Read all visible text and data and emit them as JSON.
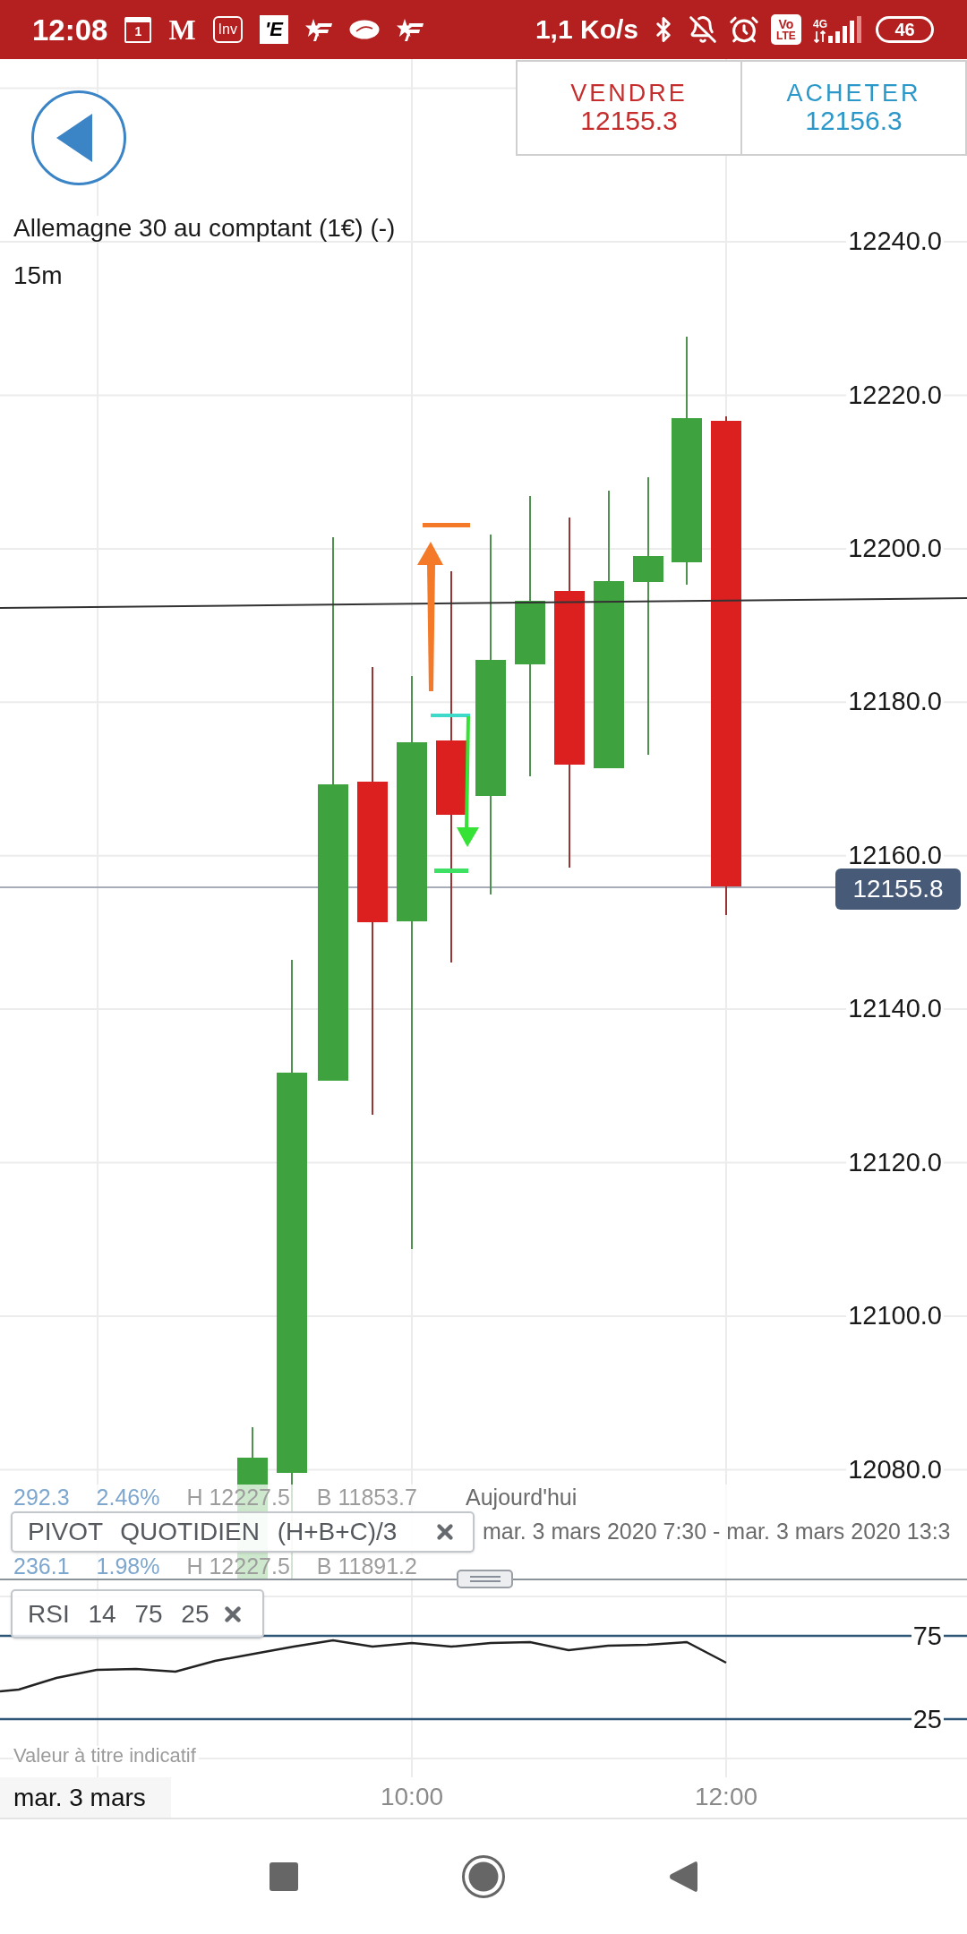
{
  "status_bar": {
    "time": "12:08",
    "notification_icons": [
      {
        "kind": "calendar",
        "text": "1"
      },
      {
        "kind": "serif_letter",
        "text": "M"
      },
      {
        "kind": "outlined_text",
        "text": "Inv"
      },
      {
        "kind": "tile_letter",
        "text": "'E"
      },
      {
        "kind": "star_logo"
      },
      {
        "kind": "oval_logo"
      },
      {
        "kind": "star_logo"
      }
    ],
    "net_speed": "1,1 Ko/s",
    "volte": {
      "top": "Vo",
      "bottom": "LTE"
    },
    "network_type": "4G",
    "battery": "46"
  },
  "trade_buttons": [
    {
      "kind": "sell",
      "label": "VENDRE",
      "price": "12155.3"
    },
    {
      "kind": "buy",
      "label": "ACHETER",
      "price": "12156.3"
    }
  ],
  "chart": {
    "instrument": "Allemagne 30 au comptant (1€) (-)",
    "timeframe": "15m",
    "price_labels": [
      "12240.0",
      "12220.0",
      "12200.0",
      "12180.0",
      "12160.0",
      "12140.0",
      "12120.0",
      "12100.0",
      "12080.0"
    ],
    "current_price": "12155.8",
    "stats": [
      {
        "change": "292.3",
        "change_pct": "2.46%",
        "high": "H 12227.5",
        "low": "B 11853.7"
      },
      {
        "change": "236.1",
        "change_pct": "1.98%",
        "high": "H 12227.5",
        "low": "B 11891.2"
      }
    ],
    "period": "Aujourd'hui",
    "period_range": "mar. 3 mars 2020 7:30 - mar. 3 mars 2020 13:3",
    "indicator": {
      "label": "PIVOT QUOTIDIEN (H+B+C)/3"
    }
  },
  "rsi_panel": {
    "indicator": {
      "label": "RSI 14 75 25"
    },
    "levels": [
      "75",
      "25"
    ],
    "disclaimer": "Valeur à titre indicatif"
  },
  "time_axis": {
    "date": "mar. 3 mars",
    "labels": [
      "10:00",
      "12:00"
    ]
  }
}
